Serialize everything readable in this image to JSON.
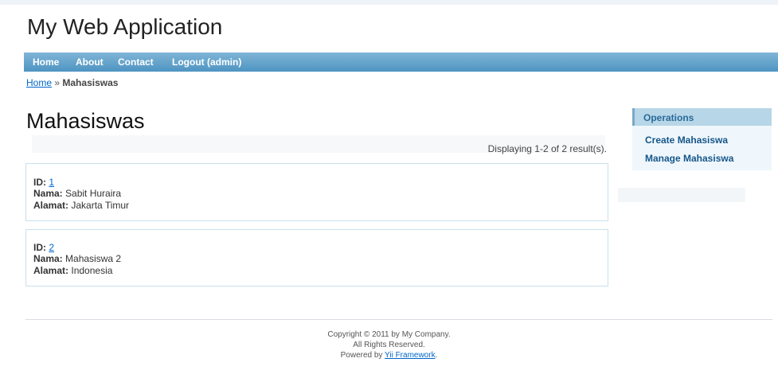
{
  "header": {
    "title": "My Web Application"
  },
  "nav": [
    {
      "label": "Home"
    },
    {
      "label": "About"
    },
    {
      "label": "Contact"
    },
    {
      "label": "Logout (admin)"
    }
  ],
  "breadcrumb": {
    "home": "Home",
    "separator": "»",
    "current": "Mahasiswas"
  },
  "main": {
    "title": "Mahasiswas",
    "summary": "Displaying 1-2 of 2 result(s).",
    "items": [
      {
        "id_label": "ID:",
        "id": "1",
        "nama_label": "Nama:",
        "nama": "Sabit Huraira",
        "alamat_label": "Alamat:",
        "alamat": "Jakarta Timur"
      },
      {
        "id_label": "ID:",
        "id": "2",
        "nama_label": "Nama:",
        "nama": "Mahasiswa 2",
        "alamat_label": "Alamat:",
        "alamat": "Indonesia"
      }
    ]
  },
  "sidebar": {
    "title": "Operations",
    "links": [
      {
        "label": "Create Mahasiswa"
      },
      {
        "label": "Manage Mahasiswa"
      }
    ]
  },
  "footer": {
    "line1": "Copyright © 2011 by My Company.",
    "line2": "All Rights Reserved.",
    "line3_prefix": "Powered by",
    "line3_link": "Yii Framework",
    "line3_suffix": "."
  }
}
